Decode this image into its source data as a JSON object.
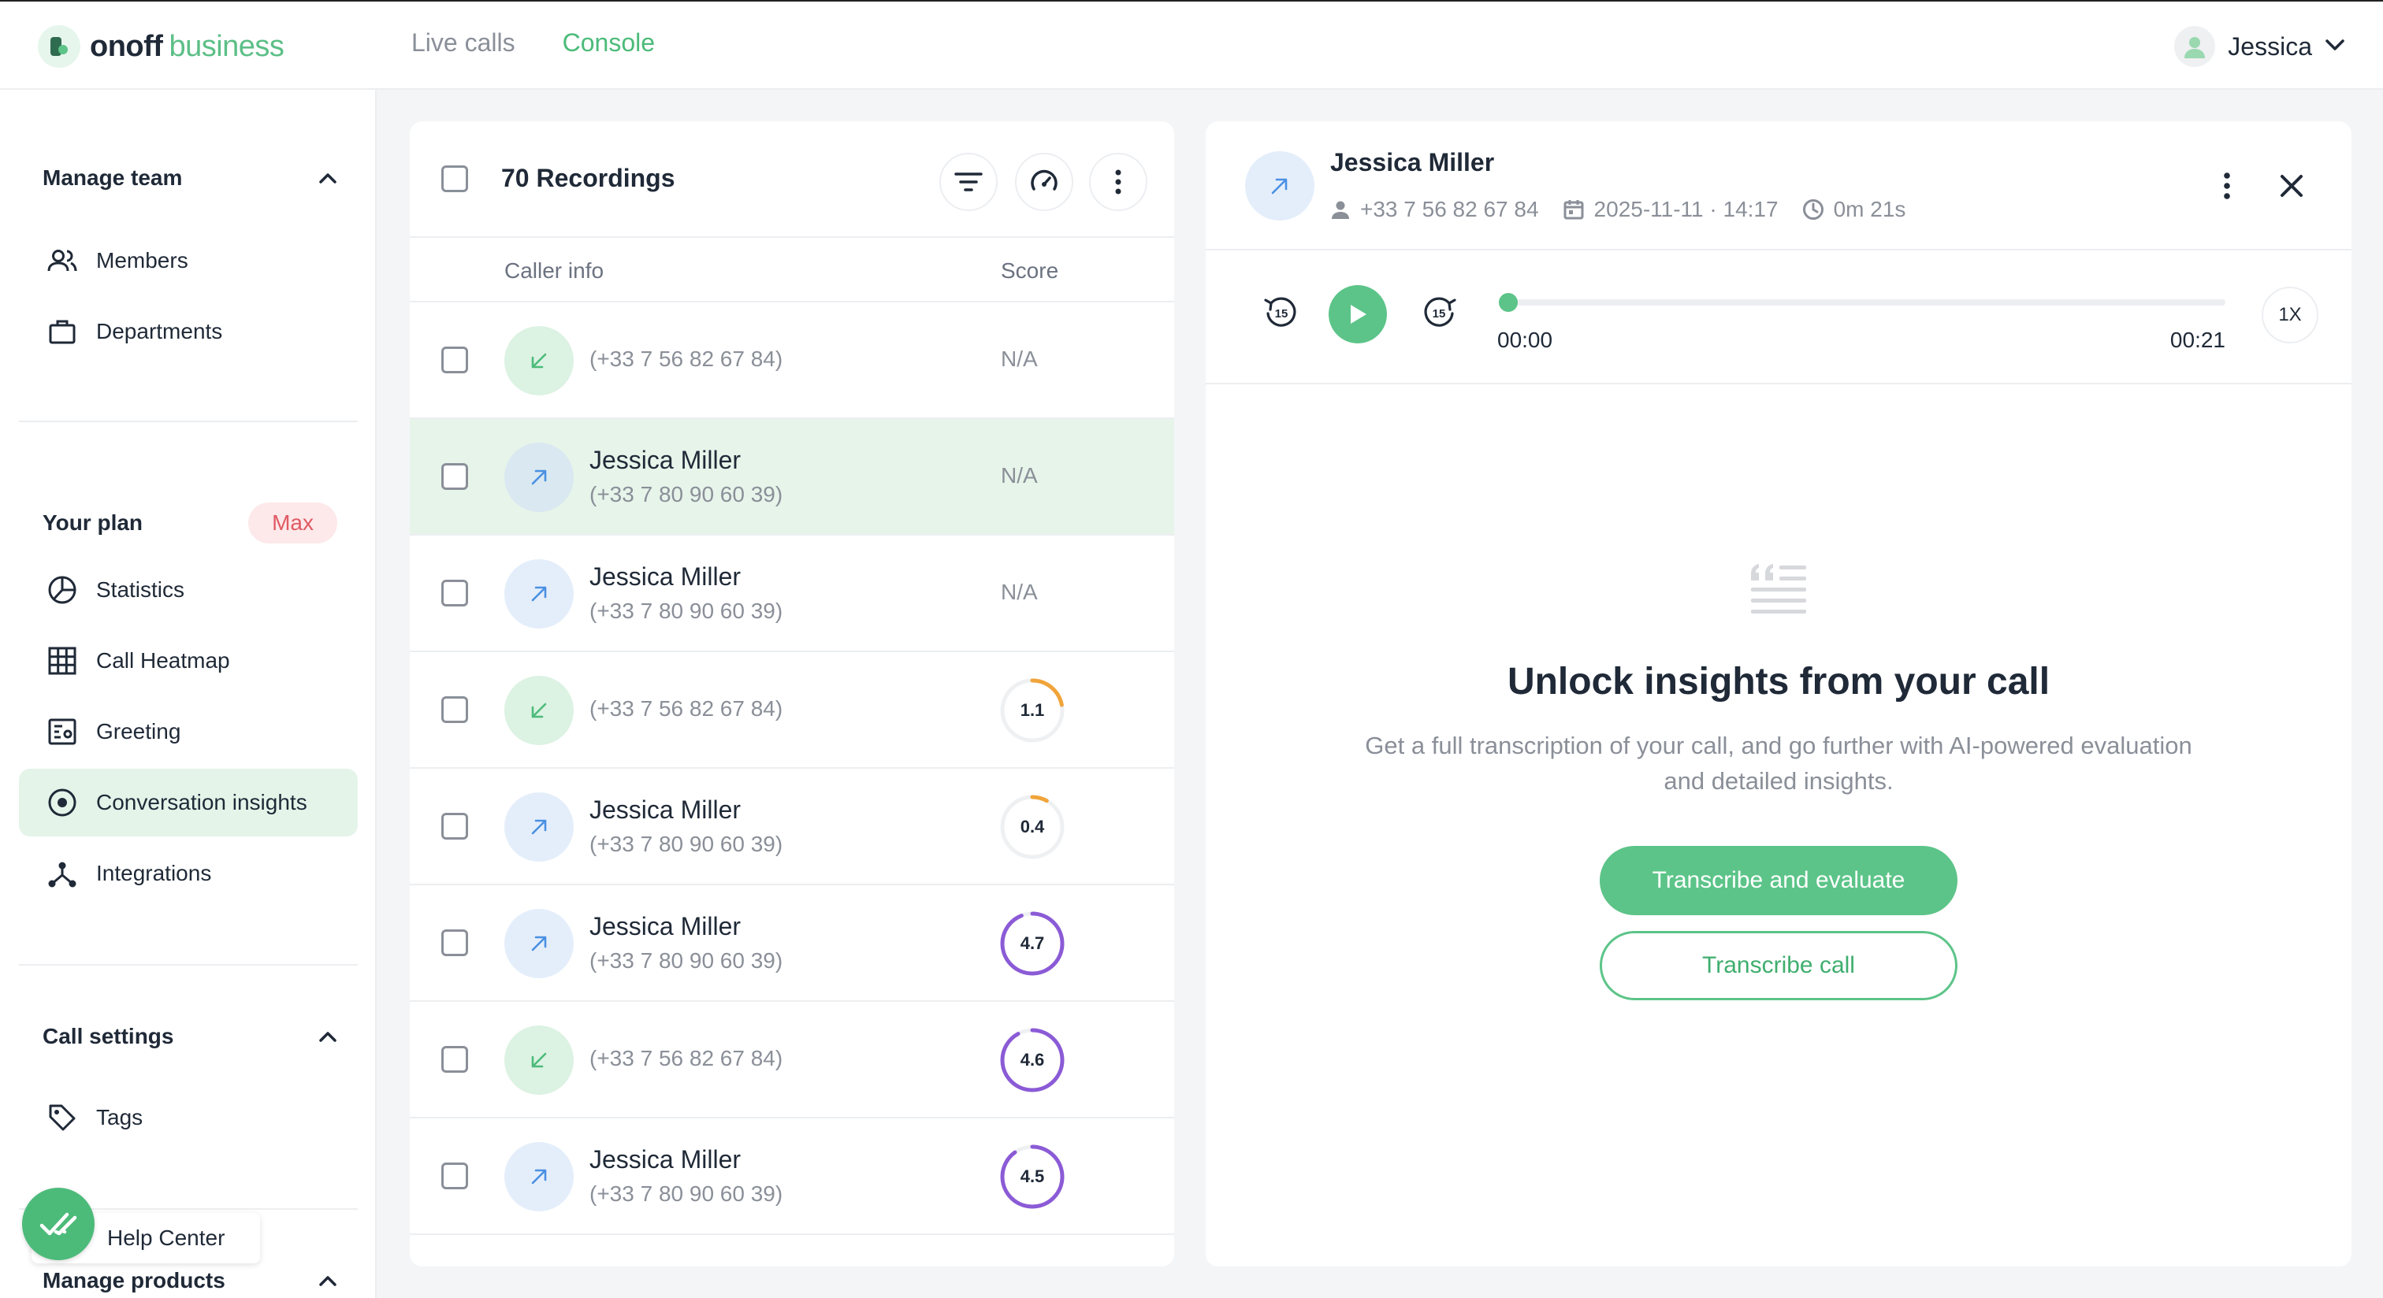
{
  "header": {
    "logo_bold": "onoff",
    "logo_light": "business",
    "nav": [
      {
        "label": "Live calls",
        "active": false
      },
      {
        "label": "Console",
        "active": true
      }
    ],
    "user_name": "Jessica"
  },
  "sidebar": {
    "manage_team": {
      "title": "Manage team",
      "items": [
        {
          "label": "Members",
          "icon": "users-icon"
        },
        {
          "label": "Departments",
          "icon": "briefcase-icon"
        }
      ]
    },
    "plan": {
      "title": "Your plan",
      "badge": "Max",
      "items": [
        {
          "label": "Statistics",
          "icon": "pie-chart-icon"
        },
        {
          "label": "Call Heatmap",
          "icon": "grid-icon"
        },
        {
          "label": "Greeting",
          "icon": "greeting-icon"
        },
        {
          "label": "Conversation insights",
          "icon": "target-icon",
          "active": true
        },
        {
          "label": "Integrations",
          "icon": "integrations-icon"
        }
      ]
    },
    "call_settings": {
      "title": "Call settings",
      "items": [
        {
          "label": "Tags",
          "icon": "tag-icon"
        }
      ]
    },
    "help_center": "Help Center",
    "manage_products": "Manage products"
  },
  "recordings": {
    "title": "70 Recordings",
    "columns": {
      "caller": "Caller info",
      "score": "Score"
    },
    "rows": [
      {
        "direction": "incoming",
        "name": "",
        "number": "(+33 7 56 82 67 84)",
        "score": "N/A"
      },
      {
        "direction": "outgoing",
        "name": "Jessica Miller",
        "number": "(+33 7 80 90 60 39)",
        "score": "N/A",
        "selected": true
      },
      {
        "direction": "outgoing",
        "name": "Jessica Miller",
        "number": "(+33 7 80 90 60 39)",
        "score": "N/A"
      },
      {
        "direction": "incoming",
        "name": "",
        "number": "(+33 7 56 82 67 84)",
        "score": "1.1",
        "score_fraction": 0.22,
        "score_color": "#f0a43a"
      },
      {
        "direction": "outgoing",
        "name": "Jessica Miller",
        "number": "(+33 7 80 90 60 39)",
        "score": "0.4",
        "score_fraction": 0.08,
        "score_color": "#f0a43a"
      },
      {
        "direction": "outgoing",
        "name": "Jessica Miller",
        "number": "(+33 7 80 90 60 39)",
        "score": "4.7",
        "score_fraction": 0.94,
        "score_color": "#8b5bd6"
      },
      {
        "direction": "incoming",
        "name": "",
        "number": "(+33 7 56 82 67 84)",
        "score": "4.6",
        "score_fraction": 0.92,
        "score_color": "#8b5bd6"
      },
      {
        "direction": "outgoing",
        "name": "Jessica Miller",
        "number": "(+33 7 80 90 60 39)",
        "score": "4.5",
        "score_fraction": 0.9,
        "score_color": "#8b5bd6"
      }
    ]
  },
  "detail": {
    "name": "Jessica Miller",
    "phone": "+33 7 56 82 67 84",
    "datetime": "2025-11-11 · 14:17",
    "duration": "0m 21s",
    "player": {
      "current": "00:00",
      "total": "00:21",
      "speed": "1X",
      "progress": 0,
      "skip_seconds": "15"
    },
    "empty": {
      "title": "Unlock insights from your call",
      "description": "Get a full transcription of your call, and go further with AI-powered evaluation and detailed insights.",
      "primary_button": "Transcribe and evaluate",
      "secondary_button": "Transcribe call"
    }
  },
  "colors": {
    "accent": "#5cc488",
    "incoming_arrow": "#4cbb7a",
    "outgoing_arrow": "#4a90e2",
    "plan_badge": "#e05a63"
  }
}
